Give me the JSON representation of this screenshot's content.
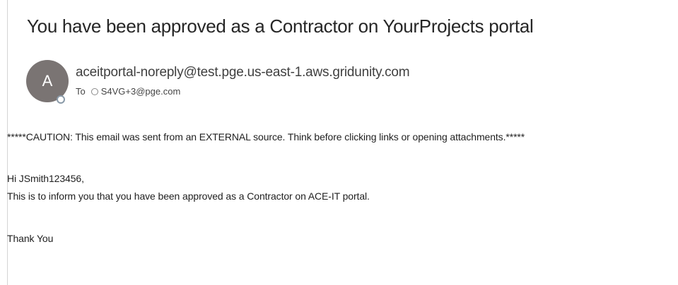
{
  "email": {
    "subject": "You have been approved as a Contractor on YourProjects portal",
    "sender": {
      "avatar_initial": "A",
      "avatar_color": "#7a7473",
      "address": "aceitportal-noreply@test.pge.us-east-1.aws.gridunity.com"
    },
    "to_label": "To",
    "recipient": "S4VG+3@pge.com",
    "caution_banner": "*****CAUTION: This email was sent from an EXTERNAL source. Think before clicking links or opening attachments.*****",
    "body": {
      "greeting": "Hi JSmith123456,",
      "message": "This is to inform you that you have been approved as a Contractor on ACE-IT portal.",
      "closing": "Thank You"
    }
  }
}
